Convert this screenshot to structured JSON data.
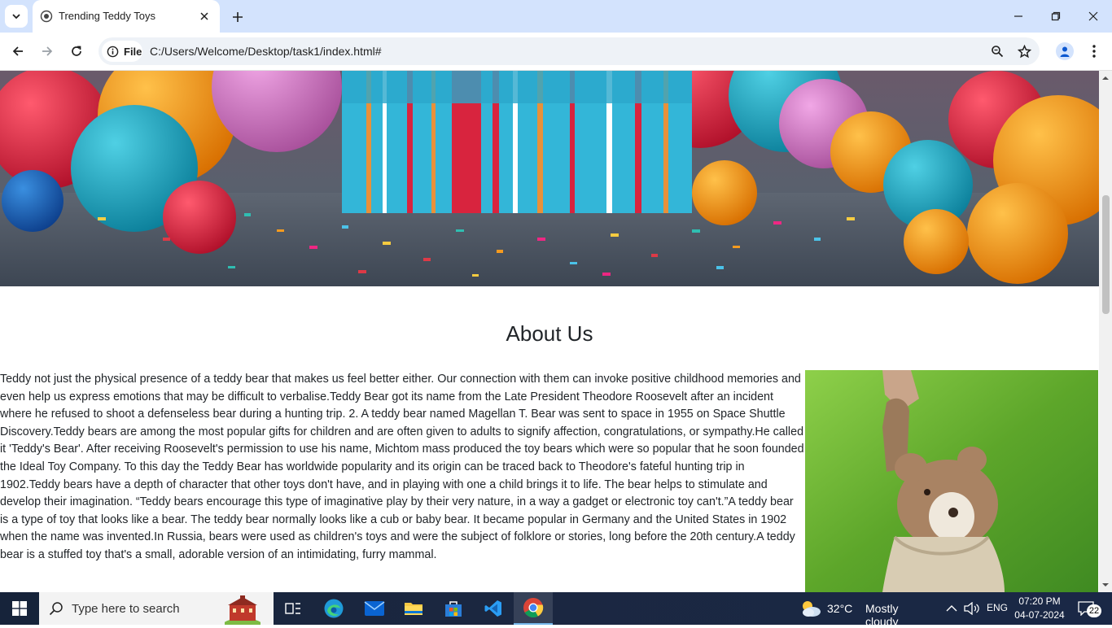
{
  "browser": {
    "tab": {
      "title": "Trending Teddy Toys"
    },
    "address": {
      "scheme_label": "File",
      "url": "C:/Users/Welcome/Desktop/task1/index.html#"
    }
  },
  "page": {
    "about": {
      "heading": "About Us",
      "body": "Teddy not just the physical presence of a teddy bear that makes us feel better either. Our connection with them can invoke positive childhood memories and even help us express emotions that may be difficult to verbalise.Teddy Bear got its name from the Late President Theodore Roosevelt after an incident where he refused to shoot a defenseless bear during a hunting trip. 2. A teddy bear named Magellan T. Bear was sent to space in 1955 on Space Shuttle Discovery.Teddy bears are among the most popular gifts for children and are often given to adults to signify affection, congratulations, or sympathy.He called it 'Teddy's Bear'. After receiving Roosevelt's permission to use his name, Michtom mass produced the toy bears which were so popular that he soon founded the Ideal Toy Company. To this day the Teddy Bear has worldwide popularity and its origin can be traced back to Theodore's fateful hunting trip in 1902.Teddy bears have a depth of character that other toys don't have, and in playing with one a child brings it to life. The bear helps to stimulate and develop their imagination. “Teddy bears encourage this type of imaginative play by their very nature, in a way a gadget or electronic toy can't.”A teddy bear is a type of toy that looks like a bear. The teddy bear normally looks like a cub or baby bear. It became popular in Germany and the United States in 1902 when the name was invented.In Russia, bears were used as children's toys and were the subject of folklore or stories, long before the 20th century.A teddy bear is a stuffed toy that's a small, adorable version of an intimidating, furry mammal."
    }
  },
  "taskbar": {
    "search_placeholder": "Type here to search",
    "weather": {
      "temp": "32°C",
      "condition": "Mostly cloudy"
    },
    "language": "ENG",
    "time": "07:20 PM",
    "date": "04-07-2024",
    "notification_count": "22"
  },
  "colors": {
    "titlebar": "#d3e3fd",
    "taskbar": "#1b2740",
    "accent": "#76b9ed"
  }
}
